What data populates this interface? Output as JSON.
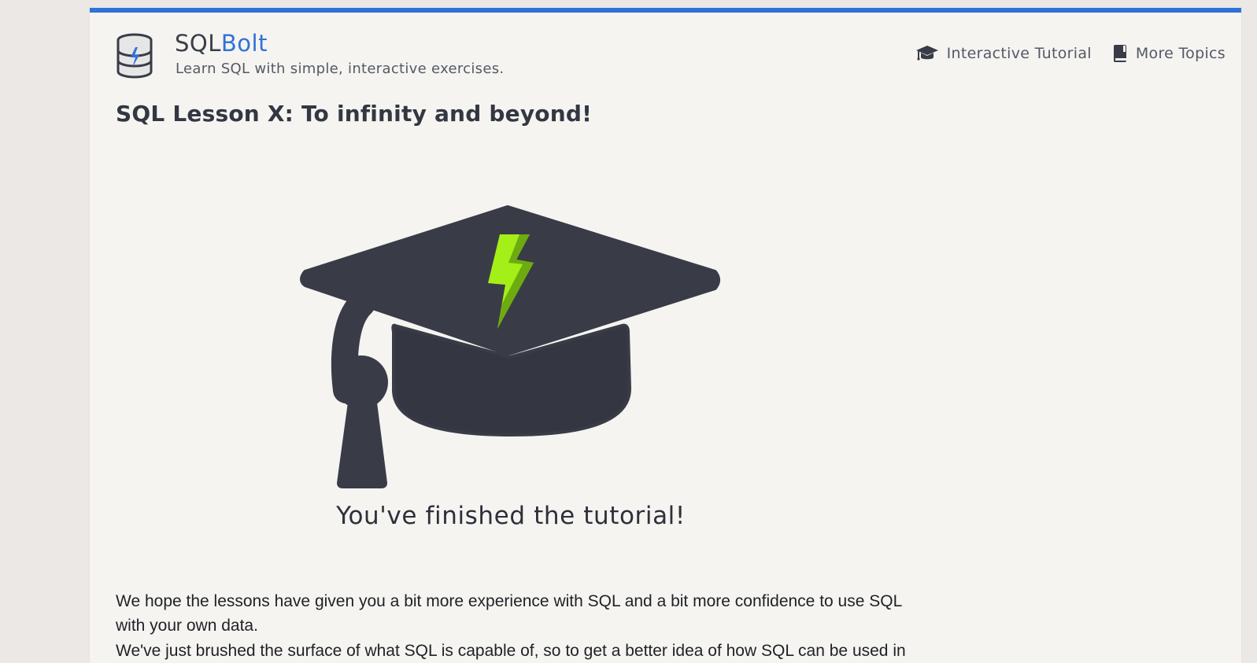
{
  "header": {
    "brand_prefix": "SQL",
    "brand_accent": "Bolt",
    "tagline": "Learn SQL with simple, interactive exercises.",
    "nav": [
      {
        "label": "Interactive Tutorial",
        "icon": "graduation-cap-icon"
      },
      {
        "label": "More Topics",
        "icon": "book-icon"
      }
    ]
  },
  "lesson": {
    "title": "SQL Lesson X: To infinity and beyond!",
    "graphic_icon": "graduation-cap-with-bolt",
    "finished_text": "You've finished the tutorial!",
    "paragraphs": [
      "We hope the lessons have given you a bit more experience with SQL and a bit more confidence to use SQL with your own data.",
      "We've just brushed the surface of what SQL is capable of, so to get a better idea of how SQL can be used in"
    ]
  },
  "colors": {
    "accent": "#2f72d8",
    "cap": "#393c47",
    "bolt": "#a3ef17",
    "page": "#f5f4f1",
    "background": "#ebe8e5"
  }
}
